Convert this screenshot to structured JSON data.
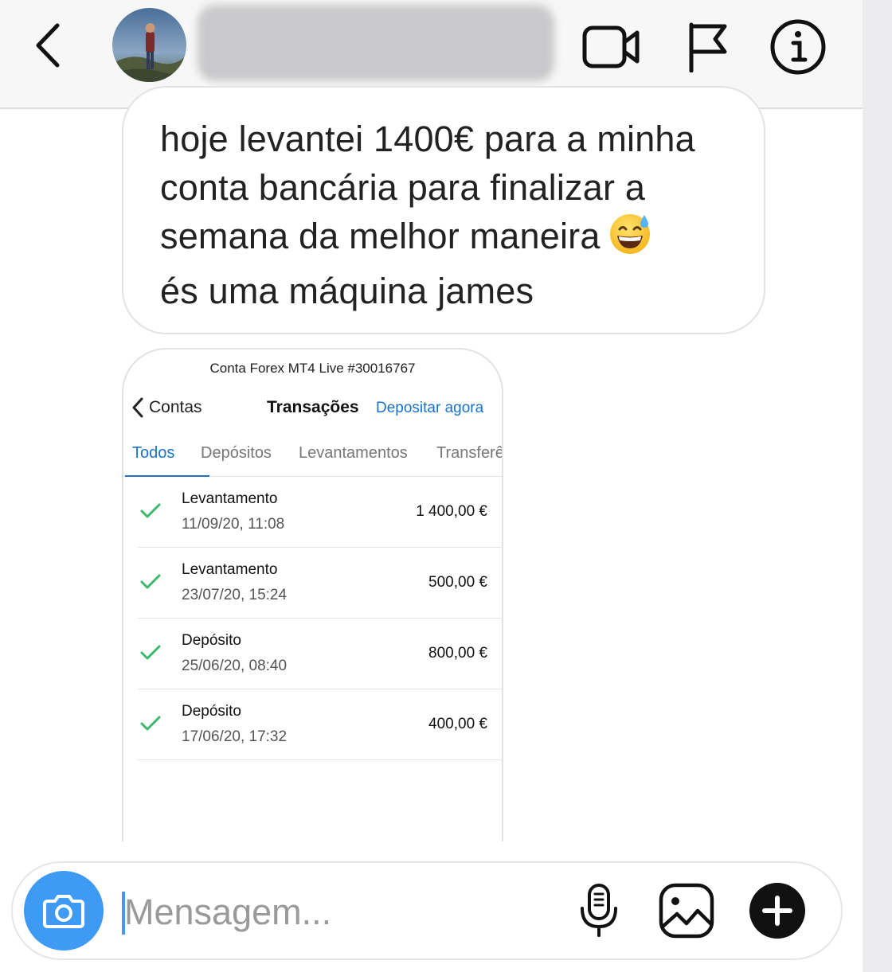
{
  "header": {
    "back_icon": "chevron-left-icon",
    "contact_name": "",
    "icons": [
      "video-call-icon",
      "flag-icon",
      "info-icon"
    ]
  },
  "message": {
    "lines": [
      "hoje levantei 1400€ para a minha",
      "conta bancária para finalizar a",
      "semana da melhor maneira",
      "és uma máquina james"
    ],
    "emoji": "grinning-face-with-sweat-emoji"
  },
  "screenshot": {
    "title": "Conta Forex MT4 Live #30016767",
    "back_label": "Contas",
    "nav_title": "Transações",
    "action_label": "Depositar agora",
    "tabs": [
      {
        "label": "Todos",
        "active": true
      },
      {
        "label": "Depósitos",
        "active": false
      },
      {
        "label": "Levantamentos",
        "active": false
      },
      {
        "label": "Transferê",
        "active": false
      }
    ],
    "transactions": [
      {
        "type": "Levantamento",
        "date": "11/09/20, 11:08",
        "amount": "1 400,00 €"
      },
      {
        "type": "Levantamento",
        "date": "23/07/20, 15:24",
        "amount": "500,00 €"
      },
      {
        "type": "Depósito",
        "date": "25/06/20, 08:40",
        "amount": "800,00 €"
      },
      {
        "type": "Depósito",
        "date": "17/06/20, 17:32",
        "amount": "400,00 €"
      }
    ],
    "status_icon": "check-icon"
  },
  "composer": {
    "placeholder": "Mensagem...",
    "icons": [
      "camera-icon",
      "microphone-icon",
      "gallery-icon",
      "plus-icon"
    ]
  },
  "colors": {
    "accent_blue": "#3f9af3",
    "link_blue": "#1a73c9",
    "check_green": "#3bb86a"
  }
}
